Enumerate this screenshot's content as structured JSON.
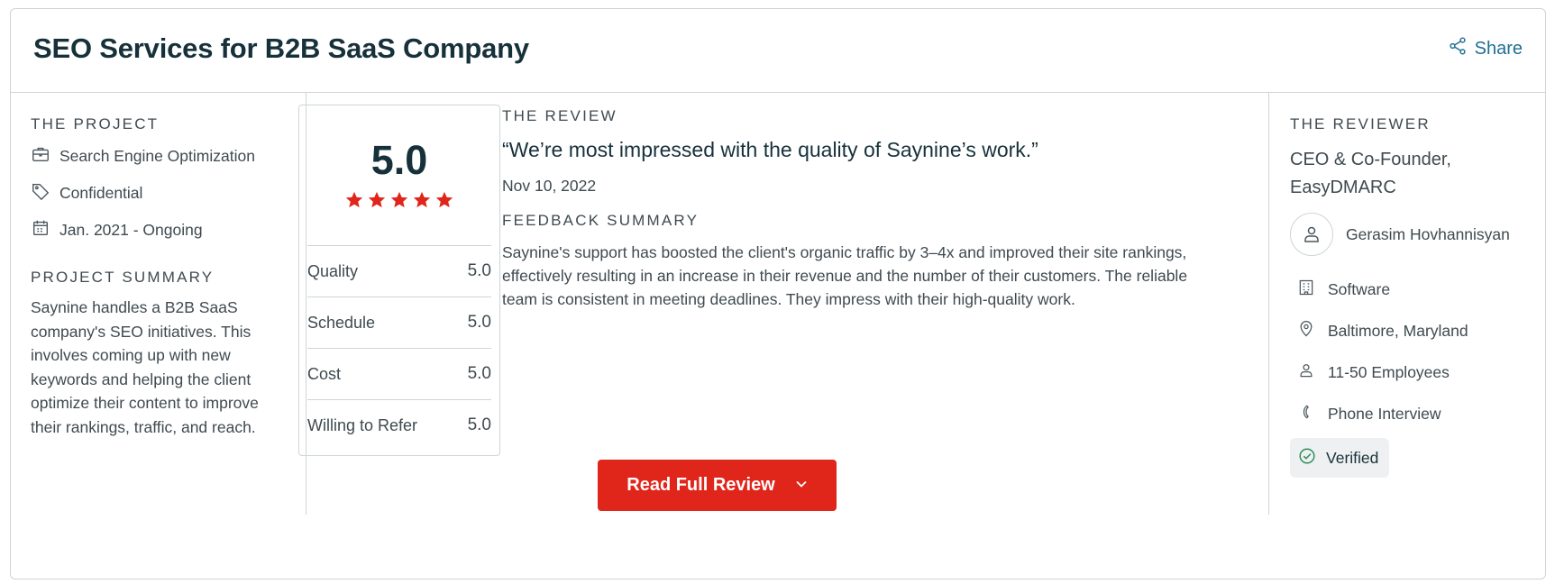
{
  "header": {
    "title": "SEO Services for B2B SaaS Company",
    "share_label": "Share"
  },
  "project": {
    "section_label": "THE PROJECT",
    "service": "Search Engine Optimization",
    "budget": "Confidential",
    "timeline": "Jan. 2021 - Ongoing",
    "summary_label": "PROJECT SUMMARY",
    "summary": "Saynine handles a B2B SaaS company's SEO initiatives. This involves coming up with new keywords and helping the client optimize their content to improve their rankings, traffic, and reach."
  },
  "rating": {
    "overall": "5.0",
    "stars": 5,
    "scores": [
      {
        "label": "Quality",
        "value": "5.0"
      },
      {
        "label": "Schedule",
        "value": "5.0"
      },
      {
        "label": "Cost",
        "value": "5.0"
      },
      {
        "label": "Willing to Refer",
        "value": "5.0"
      }
    ]
  },
  "review": {
    "section_label": "THE REVIEW",
    "quote": "“We’re most impressed with the quality of Saynine’s work.”",
    "date": "Nov 10, 2022",
    "feedback_label": "FEEDBACK SUMMARY",
    "feedback": "Saynine's support has boosted the client's organic traffic by 3–4x and improved their site rankings, effectively resulting in an increase in their revenue and the number of their customers. The reliable team is consistent in meeting deadlines. They impress with their high-quality work."
  },
  "reviewer": {
    "section_label": "THE REVIEWER",
    "role": "CEO & Co-Founder, EasyDMARC",
    "name": "Gerasim Hovhannisyan",
    "industry": "Software",
    "location": "Baltimore, Maryland",
    "size": "11-50 Employees",
    "interview": "Phone Interview",
    "verified": "Verified"
  },
  "actions": {
    "read_full": "Read Full Review"
  },
  "colors": {
    "accent": "#e0261b",
    "link": "#1e6f94",
    "text": "#17313b",
    "verified": "#2e8b57"
  },
  "icons": [
    "share-icon",
    "briefcase-icon",
    "tag-icon",
    "calendar-icon",
    "star-icon",
    "user-icon",
    "building-icon",
    "location-pin-icon",
    "employees-icon",
    "phone-icon",
    "verified-check-icon",
    "chevron-down-icon"
  ]
}
